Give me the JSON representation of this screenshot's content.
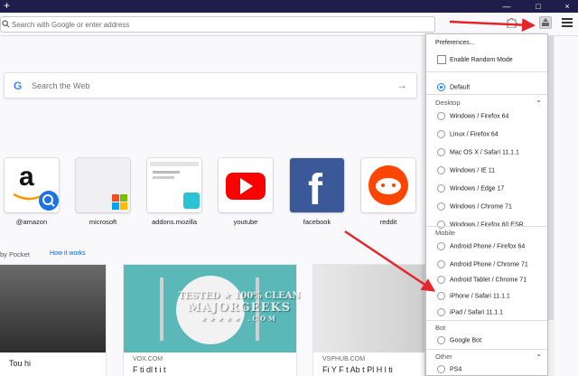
{
  "window": {
    "new_tab_glyph": "+",
    "minimize_glyph": "—",
    "maximize_glyph": "□",
    "close_glyph": "×"
  },
  "toolbar": {
    "url_placeholder": "Search with Google or enter address",
    "extension_icon": "puzzle-icon",
    "useragent_button_icon": "useragent-switcher-icon",
    "menu_icon": "hamburger-menu-icon"
  },
  "newtab": {
    "search_placeholder": "Search the Web",
    "search_brand": "G",
    "top_sites": [
      {
        "label": "@amazon"
      },
      {
        "label": "microsoft"
      },
      {
        "label": "addons.mozilla"
      },
      {
        "label": "youtube"
      },
      {
        "label": "facebook"
      },
      {
        "label": "reddit"
      }
    ],
    "pocket_heading": "by Pocket",
    "pocket_link": "How it works",
    "cards": [
      {
        "source": "",
        "title": "Tou   hi"
      },
      {
        "source": "VOX.COM",
        "title": "F   ti   dl t   i   t"
      },
      {
        "source": "VSPHUB.COM",
        "title": "Fi   Y   F   t Ab   t Pl   H   l ti"
      }
    ]
  },
  "watermark": {
    "line1": "TESTED ★ 100% CLEAN",
    "line2": "MAJORGEEKS",
    "line3": "★★★★★ .COM"
  },
  "panel": {
    "preferences": "Preferences...",
    "random_mode": "Enable Random Mode",
    "default_label": "Default",
    "groups": [
      {
        "name": "Desktop",
        "items": [
          "Windows / Firefox 64",
          "Linux / Firefox 64",
          "Mac OS X / Safari 11.1.1",
          "Windows / IE 11",
          "Windows / Edge 17",
          "Windows / Chrome 71",
          "Windows / Firefox 60 ESR"
        ]
      },
      {
        "name": "Mobile",
        "items": [
          "Android Phone / Firefox 64",
          "Android Phone / Chrome 71",
          "Android Tablet / Chrome 71",
          "iPhone / Safari 11.1.1",
          "iPad / Safari 11.1.1"
        ]
      },
      {
        "name": "Bot",
        "items": [
          "Google Bot"
        ]
      },
      {
        "name": "Other",
        "items": [
          "PS4"
        ]
      }
    ]
  },
  "colors": {
    "titlebar": "#1f1e4a",
    "accent": "#0a84ff",
    "annotation_arrow": "#e8242b"
  }
}
